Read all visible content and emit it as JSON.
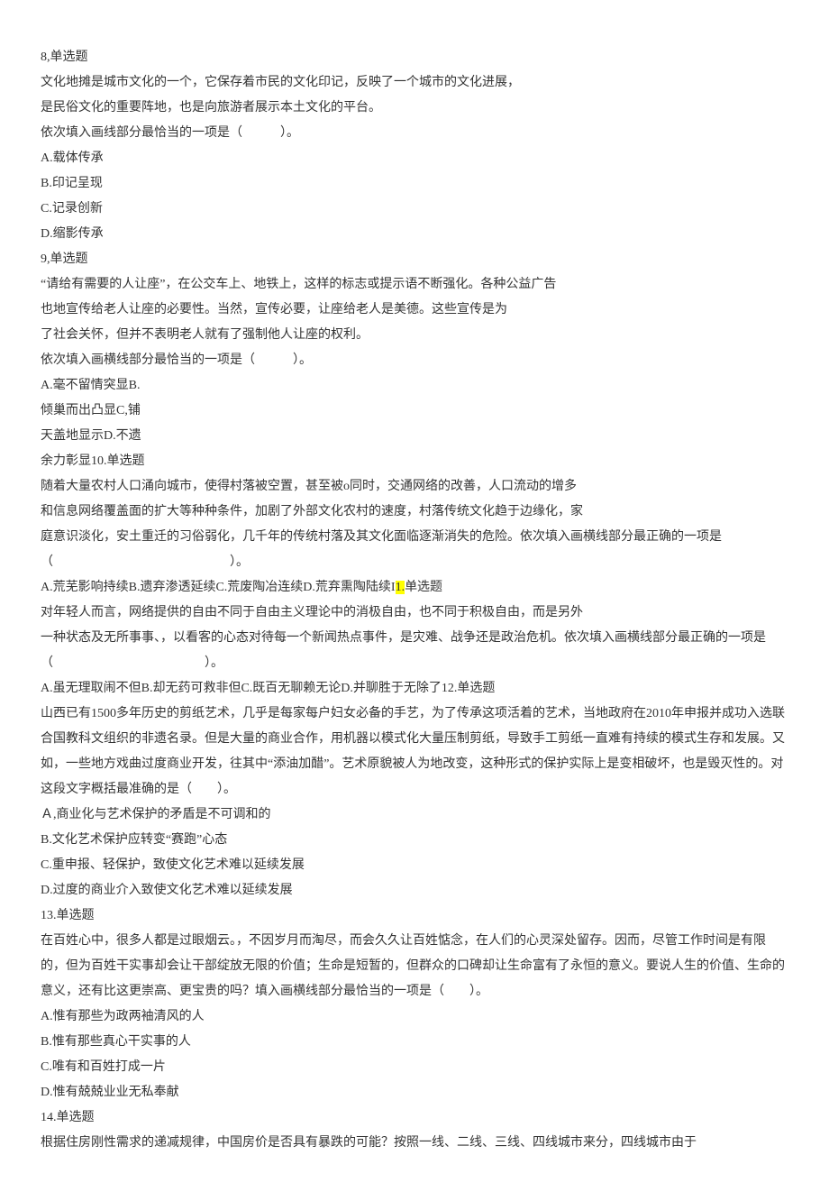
{
  "q8": {
    "header": "8,单选题",
    "p1": "文化地摊是城市文化的一个，它保存着市民的文化印记，反映了一个城市的文化进展，",
    "p2": "是民俗文化的重要阵地，也是向旅游者展示本土文化的平台。",
    "prompt": "依次填入画线部分最恰当的一项是（　　　）。",
    "a": "A.载体传承",
    "b": "B.印记呈现",
    "c": "C.记录创新",
    "d": "D.缩影传承"
  },
  "q9": {
    "header": "9,单选题",
    "p1": "“请给有需要的人让座”，在公交车上、地铁上，这样的标志或提示语不断强化。各种公益广告",
    "p2": "也地宣传给老人让座的必要性。当然，宣传必要，让座给老人是美德。这些宣传是为",
    "p3": "了社会关怀，但并不表明老人就有了强制他人让座的权利。",
    "prompt": "依次填入画横线部分最恰当的一项是（　　　）。",
    "a": "A.毫不留情突显B.",
    "b": "倾巢而出凸显C,铺",
    "c": "天盖地显示D.不遗"
  },
  "q10": {
    "header_part1": "余力彰显10.单选题",
    "p1": "随着大量农村人口涌向城市，使得村落被空置，甚至被o同时，交通网络的改善，人口流动的增多",
    "p2": "和信息网络覆盖面的扩大等种种条件，加剧了外部文化农村的速度，村落传统文化趋于边缘化，家",
    "p3": "庭意识淡化，安土重迁的习俗弱化，几千年的传统村落及其文化面临逐渐消失的危险。依次填入画横线部分最正确的一项是（　　　　　　　　　　　　　　）。",
    "opts_a": "A.荒芜影响持续B.遗弃渗透延续C.荒废陶冶连续D.荒弃熏陶陆续I",
    "opts_hl": "1.",
    "opts_b": "单选题"
  },
  "q11": {
    "p1": "对年轻人而言，网络提供的自由不同于自由主义理论中的消极自由，也不同于积极自由，而是另外",
    "p2": "一种状态及无所事事、，以看客的心态对待每一个新闻热点事件，是灾难、战争还是政治危机。依次填入画横线部分最正确的一项是（　　　　　　　　　　　　）。",
    "opts": "A.虽无理取闹不但B.却无药可救非但C.既百无聊赖无论D.并聊胜于无除了12.单选题"
  },
  "q12": {
    "p1": "山西已有1500多年历史的剪纸艺术，几乎是每家每户妇女必备的手艺，为了传承这项活着的艺术，当地政府在2010年申报并成功入选联合国教科文组织的非遗名录。但是大量的商业合作，用机器以模式化大量压制剪纸，导致手工剪纸一直难有持续的模式生存和发展。又如，一些地方戏曲过度商业开发，往其中“添油加醋”。艺术原貌被人为地改变，这种形式的保护实际上是变相破坏，也是毁灭性的。对这段文字概括最准确的是（　　）。",
    "a": "Ａ,商业化与艺术保护的矛盾是不可调和的",
    "b": "B.文化艺术保护应转变“赛跑”心态",
    "c": "C.重申报、轻保护，致使文化艺术难以延续发展",
    "d": "D.过度的商业介入致使文化艺术难以延续发展"
  },
  "q13": {
    "header": "13.单选题",
    "p1": "在百姓心中，很多人都是过眼烟云。，不因岁月而淘尽，而会久久让百姓惦念，在人们的心灵深处留存。因而，尽管工作时间是有限的，但为百姓干实事却会让干部绽放无限的价值；生命是短暂的，但群众的口碑却让生命富有了永恒的意义。要说人生的价值、生命的意义，还有比这更崇高、更宝贵的吗？填入画横线部分最恰当的一项是（　　）。",
    "a": "A.惟有那些为政两袖清风的人",
    "b": "B.惟有那些真心干实事的人",
    "c": "C.唯有和百姓打成一片",
    "d": "D.惟有兢兢业业无私奉献"
  },
  "q14": {
    "header": "14.单选题",
    "p1": "根据住房刚性需求的递减规律，中国房价是否具有暴跌的可能？按照一线、二线、三线、四线城市来分，四线城市由于"
  }
}
